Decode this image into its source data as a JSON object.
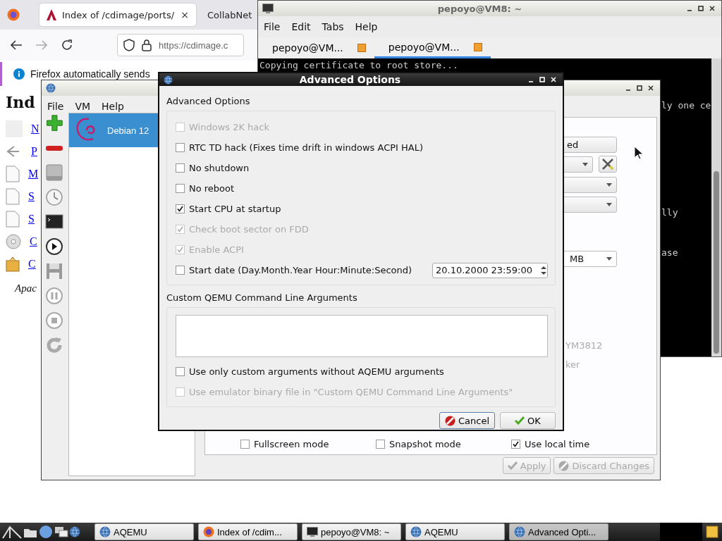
{
  "browser": {
    "tabs": [
      {
        "label": "Index of /cdimage/ports/",
        "selected": true
      },
      {
        "label": "CollabNet",
        "selected": false
      }
    ],
    "tab_close": "×",
    "url": "https://cdimage.c",
    "notification": "Firefox automatically sends",
    "page": {
      "heading": "Ind",
      "links": [
        {
          "text": "N",
          "kind": "blank"
        },
        {
          "text": "P",
          "kind": "back"
        },
        {
          "text": "M",
          "kind": "doc"
        },
        {
          "text": "S",
          "kind": "doc"
        },
        {
          "text": "S",
          "kind": "doc"
        },
        {
          "text": "C",
          "kind": "disc"
        },
        {
          "text": "C",
          "kind": "package"
        }
      ],
      "footer": "Apac"
    }
  },
  "terminal": {
    "title": "pepoyo@VM8: ~",
    "menu": [
      "File",
      "Edit",
      "Tabs",
      "Help"
    ],
    "tabs": [
      {
        "label": "pepoyo@VM...",
        "selected": false
      },
      {
        "label": "pepoyo@VM...",
        "selected": true
      }
    ],
    "lines": [
      "Copying certificate to root store...",
      "ly one ce",
      "lly",
      "ase"
    ]
  },
  "aqemu": {
    "menu": [
      "File",
      "VM",
      "Help"
    ],
    "vms": [
      {
        "name": "Debian 12",
        "selected": true
      }
    ],
    "settings": {
      "button": "ed",
      "memory": "MB",
      "sound_card": "YM3812",
      "speaker": "ker",
      "checks": [
        {
          "label": "Fullscreen mode",
          "checked": false
        },
        {
          "label": "Snapshot mode",
          "checked": false
        },
        {
          "label": "Use local time",
          "checked": true
        }
      ]
    },
    "buttons": [
      {
        "label": "Apply",
        "kind": "apply",
        "disabled": true
      },
      {
        "label": "Discard Changes",
        "kind": "discard",
        "disabled": true
      }
    ]
  },
  "dialog": {
    "title": "Advanced Options",
    "group": "Advanced Options",
    "options": [
      {
        "label": "Windows 2K hack",
        "checked": false,
        "disabled": true
      },
      {
        "label": "RTC TD hack (Fixes time drift in windows ACPI HAL)",
        "checked": false,
        "disabled": false
      },
      {
        "label": "No shutdown",
        "checked": false,
        "disabled": false
      },
      {
        "label": "No reboot",
        "checked": false,
        "disabled": false
      },
      {
        "label": "Start CPU at startup",
        "checked": true,
        "disabled": false
      },
      {
        "label": "Check boot sector on FDD",
        "checked": true,
        "disabled": true
      },
      {
        "label": "Enable ACPI",
        "checked": true,
        "disabled": true
      },
      {
        "label": "Start date (Day.Month.Year Hour:Minute:Second)",
        "checked": false,
        "disabled": false,
        "date": "20.10.2000 23:59:00"
      }
    ],
    "custom_title": "Custom QEMU Command Line Arguments",
    "custom_options": [
      {
        "label": "Use only custom arguments without AQEMU arguments",
        "checked": false,
        "disabled": false
      },
      {
        "label": "Use emulator binary file in \"Custom QEMU Command Line Arguments\"",
        "checked": false,
        "disabled": true
      }
    ],
    "buttons": [
      {
        "label": "Cancel",
        "kind": "cancel"
      },
      {
        "label": "OK",
        "kind": "ok"
      }
    ]
  },
  "taskbar": {
    "tasks": [
      {
        "label": "AQEMU",
        "kind": "aqemu",
        "selected": false
      },
      {
        "label": "Index of /cdim...",
        "kind": "firefox",
        "selected": false
      },
      {
        "label": "pepoyo@VM8: ~",
        "kind": "terminal",
        "selected": false
      },
      {
        "label": "AQEMU",
        "kind": "aqemu",
        "selected": false
      },
      {
        "label": "Advanced Opti...",
        "kind": "aqemu",
        "selected": true
      }
    ]
  }
}
